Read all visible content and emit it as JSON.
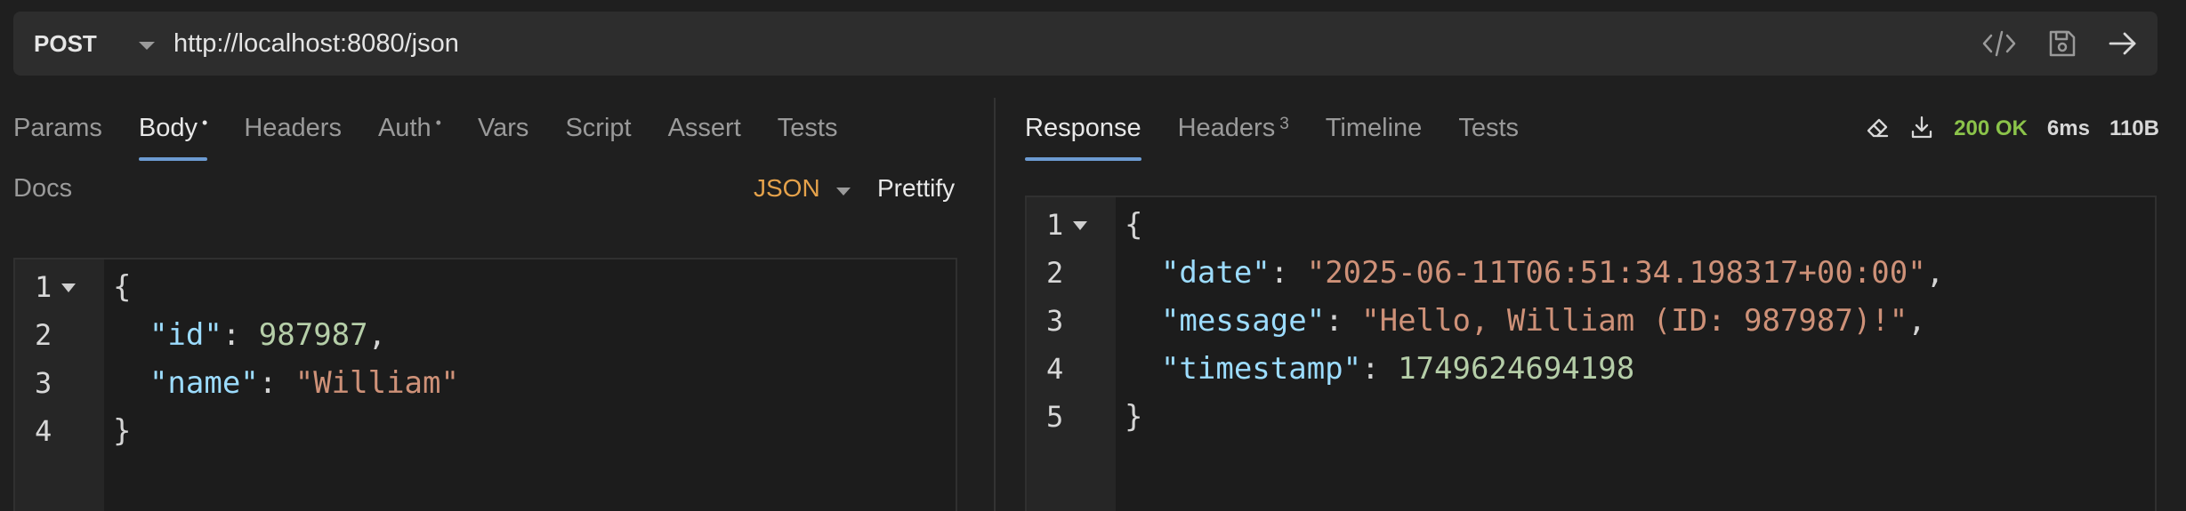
{
  "request": {
    "method": "POST",
    "url": "http://localhost:8080/json",
    "icons": [
      "code-icon",
      "save-icon",
      "send-arrow-icon"
    ]
  },
  "request_tabs": [
    {
      "label": "Params",
      "active": false
    },
    {
      "label": "Body",
      "active": true,
      "indicator": "•"
    },
    {
      "label": "Headers",
      "active": false
    },
    {
      "label": "Auth",
      "active": false,
      "indicator": "•"
    },
    {
      "label": "Vars",
      "active": false
    },
    {
      "label": "Script",
      "active": false
    },
    {
      "label": "Assert",
      "active": false
    },
    {
      "label": "Tests",
      "active": false
    }
  ],
  "docs_tab": "Docs",
  "body_mode": "JSON",
  "prettify_label": "Prettify",
  "request_body": [
    {
      "num": "1",
      "tokens": [
        [
          "p",
          "{"
        ]
      ]
    },
    {
      "num": "2",
      "tokens": [
        [
          "p",
          "  "
        ],
        [
          "k",
          "\"id\""
        ],
        [
          "p",
          ": "
        ],
        [
          "n",
          "987987"
        ],
        [
          "p",
          ","
        ]
      ]
    },
    {
      "num": "3",
      "tokens": [
        [
          "p",
          "  "
        ],
        [
          "k",
          "\"name\""
        ],
        [
          "p",
          ": "
        ],
        [
          "s",
          "\"William\""
        ]
      ]
    },
    {
      "num": "4",
      "tokens": [
        [
          "p",
          "}"
        ]
      ]
    }
  ],
  "response_tabs": [
    {
      "label": "Response",
      "active": true
    },
    {
      "label": "Headers",
      "active": false,
      "count": "3"
    },
    {
      "label": "Timeline",
      "active": false
    },
    {
      "label": "Tests",
      "active": false
    }
  ],
  "response_status": {
    "code": "200 OK",
    "time": "6ms",
    "size": "110B",
    "color": "#8bc34a"
  },
  "response_body": [
    {
      "num": "1",
      "tokens": [
        [
          "p",
          "{"
        ]
      ]
    },
    {
      "num": "2",
      "tokens": [
        [
          "p",
          "  "
        ],
        [
          "k",
          "\"date\""
        ],
        [
          "p",
          ": "
        ],
        [
          "s",
          "\"2025-06-11T06:51:34.198317+00:00\""
        ],
        [
          "p",
          ","
        ]
      ]
    },
    {
      "num": "3",
      "tokens": [
        [
          "p",
          "  "
        ],
        [
          "k",
          "\"message\""
        ],
        [
          "p",
          ": "
        ],
        [
          "s",
          "\"Hello, William (ID: 987987)!\""
        ],
        [
          "p",
          ","
        ]
      ]
    },
    {
      "num": "4",
      "tokens": [
        [
          "p",
          "  "
        ],
        [
          "k",
          "\"timestamp\""
        ],
        [
          "p",
          ": "
        ],
        [
          "n",
          "1749624694198"
        ]
      ]
    },
    {
      "num": "5",
      "tokens": [
        [
          "p",
          "}"
        ]
      ]
    }
  ],
  "colors": {
    "accent": "#6c9bd2",
    "json_mode": "#e5a24b",
    "key": "#9cdcfe",
    "string": "#ce9178",
    "number": "#b5cea8"
  }
}
